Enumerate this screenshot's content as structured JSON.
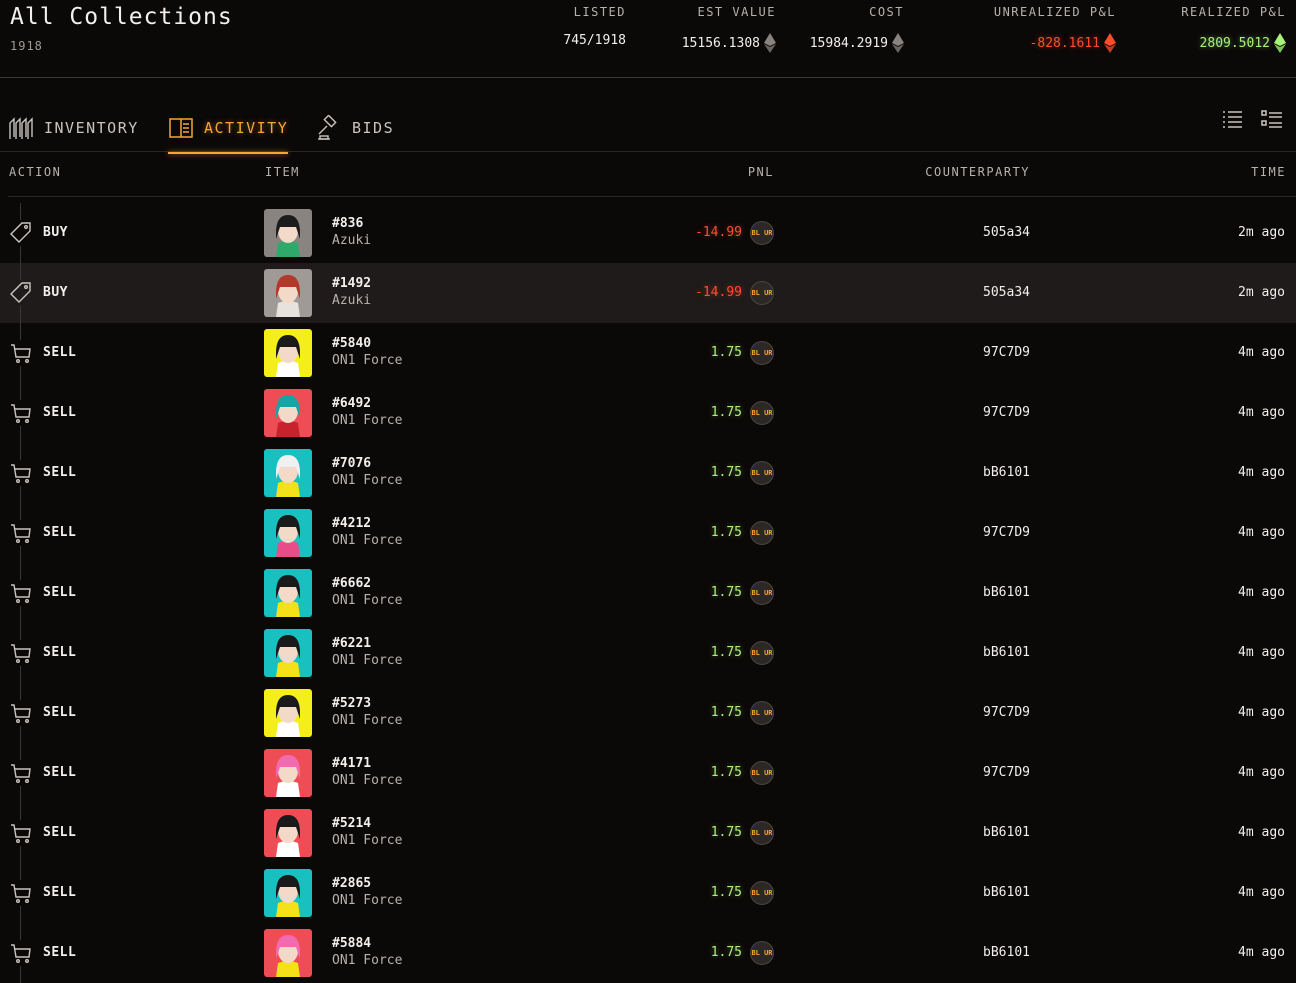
{
  "header": {
    "title": "All Collections",
    "subtitle": "1918",
    "stats": [
      {
        "label": "LISTED",
        "value": "745/1918",
        "icon": "",
        "tone": ""
      },
      {
        "label": "EST VALUE",
        "value": "15156.1308",
        "icon": "eth-icon",
        "tone": ""
      },
      {
        "label": "COST",
        "value": "15984.2919",
        "icon": "eth-icon",
        "tone": ""
      },
      {
        "label": "UNREALIZED P&L",
        "value": "-828.1611",
        "icon": "eth-icon",
        "tone": "neg"
      },
      {
        "label": "REALIZED P&L",
        "value": "2809.5012",
        "icon": "eth-icon",
        "tone": "pos"
      }
    ]
  },
  "tabs": [
    {
      "label": "INVENTORY",
      "icon": "inventory-icon",
      "active": false
    },
    {
      "label": "ACTIVITY",
      "icon": "activity-book-icon",
      "active": true
    },
    {
      "label": "BIDS",
      "icon": "gavel-icon",
      "active": false
    }
  ],
  "view_buttons": [
    "list-view-icon",
    "detail-list-view-icon"
  ],
  "columns": {
    "action": "ACTION",
    "item": "ITEM",
    "pnl": "PNL",
    "counterparty": "COUNTERPARTY",
    "time": "TIME"
  },
  "token_label": "BL UR",
  "colors": {
    "accent": "#f7a531",
    "negative": "#ff4d2a",
    "positive": "#a8f27a",
    "background": "#0b0808"
  },
  "rows": [
    {
      "action": "BUY",
      "id": "#836",
      "collection": "Azuki",
      "pnl": "-14.99",
      "counterparty": "505a34",
      "time": "2m ago",
      "thumb_bg": "#8a8480",
      "hair": "#1c1c1c",
      "accent": "#2fa86a"
    },
    {
      "action": "BUY",
      "id": "#1492",
      "collection": "Azuki",
      "pnl": "-14.99",
      "counterparty": "505a34",
      "time": "2m ago",
      "thumb_bg": "#a09a96",
      "hair": "#b2382b",
      "accent": "#e8e2dc"
    },
    {
      "action": "SELL",
      "id": "#5840",
      "collection": "ON1 Force",
      "pnl": "1.75",
      "counterparty": "97C7D9",
      "time": "4m ago",
      "thumb_bg": "#f4ee1a",
      "hair": "#1a1a1a",
      "accent": "#ffffff"
    },
    {
      "action": "SELL",
      "id": "#6492",
      "collection": "ON1 Force",
      "pnl": "1.75",
      "counterparty": "97C7D9",
      "time": "4m ago",
      "thumb_bg": "#ef4d55",
      "hair": "#1aa3a5",
      "accent": "#c8232c"
    },
    {
      "action": "SELL",
      "id": "#7076",
      "collection": "ON1 Force",
      "pnl": "1.75",
      "counterparty": "bB6101",
      "time": "4m ago",
      "thumb_bg": "#19c0c0",
      "hair": "#f0f0f0",
      "accent": "#f4e11a"
    },
    {
      "action": "SELL",
      "id": "#4212",
      "collection": "ON1 Force",
      "pnl": "1.75",
      "counterparty": "97C7D9",
      "time": "4m ago",
      "thumb_bg": "#19c0c0",
      "hair": "#1a1a1a",
      "accent": "#e84d8a"
    },
    {
      "action": "SELL",
      "id": "#6662",
      "collection": "ON1 Force",
      "pnl": "1.75",
      "counterparty": "bB6101",
      "time": "4m ago",
      "thumb_bg": "#19c0c0",
      "hair": "#1a1a1a",
      "accent": "#f4e11a"
    },
    {
      "action": "SELL",
      "id": "#6221",
      "collection": "ON1 Force",
      "pnl": "1.75",
      "counterparty": "bB6101",
      "time": "4m ago",
      "thumb_bg": "#19c0c0",
      "hair": "#1a1a1a",
      "accent": "#f4e11a"
    },
    {
      "action": "SELL",
      "id": "#5273",
      "collection": "ON1 Force",
      "pnl": "1.75",
      "counterparty": "97C7D9",
      "time": "4m ago",
      "thumb_bg": "#f4ee1a",
      "hair": "#1a1a1a",
      "accent": "#ffffff"
    },
    {
      "action": "SELL",
      "id": "#4171",
      "collection": "ON1 Force",
      "pnl": "1.75",
      "counterparty": "97C7D9",
      "time": "4m ago",
      "thumb_bg": "#ef4d55",
      "hair": "#f26ab0",
      "accent": "#ffffff"
    },
    {
      "action": "SELL",
      "id": "#5214",
      "collection": "ON1 Force",
      "pnl": "1.75",
      "counterparty": "bB6101",
      "time": "4m ago",
      "thumb_bg": "#ef4d55",
      "hair": "#1a1a1a",
      "accent": "#ffffff"
    },
    {
      "action": "SELL",
      "id": "#2865",
      "collection": "ON1 Force",
      "pnl": "1.75",
      "counterparty": "bB6101",
      "time": "4m ago",
      "thumb_bg": "#19c0c0",
      "hair": "#1a1a1a",
      "accent": "#f4e11a"
    },
    {
      "action": "SELL",
      "id": "#5884",
      "collection": "ON1 Force",
      "pnl": "1.75",
      "counterparty": "bB6101",
      "time": "4m ago",
      "thumb_bg": "#ef4d55",
      "hair": "#f26ab0",
      "accent": "#f4e11a"
    }
  ]
}
